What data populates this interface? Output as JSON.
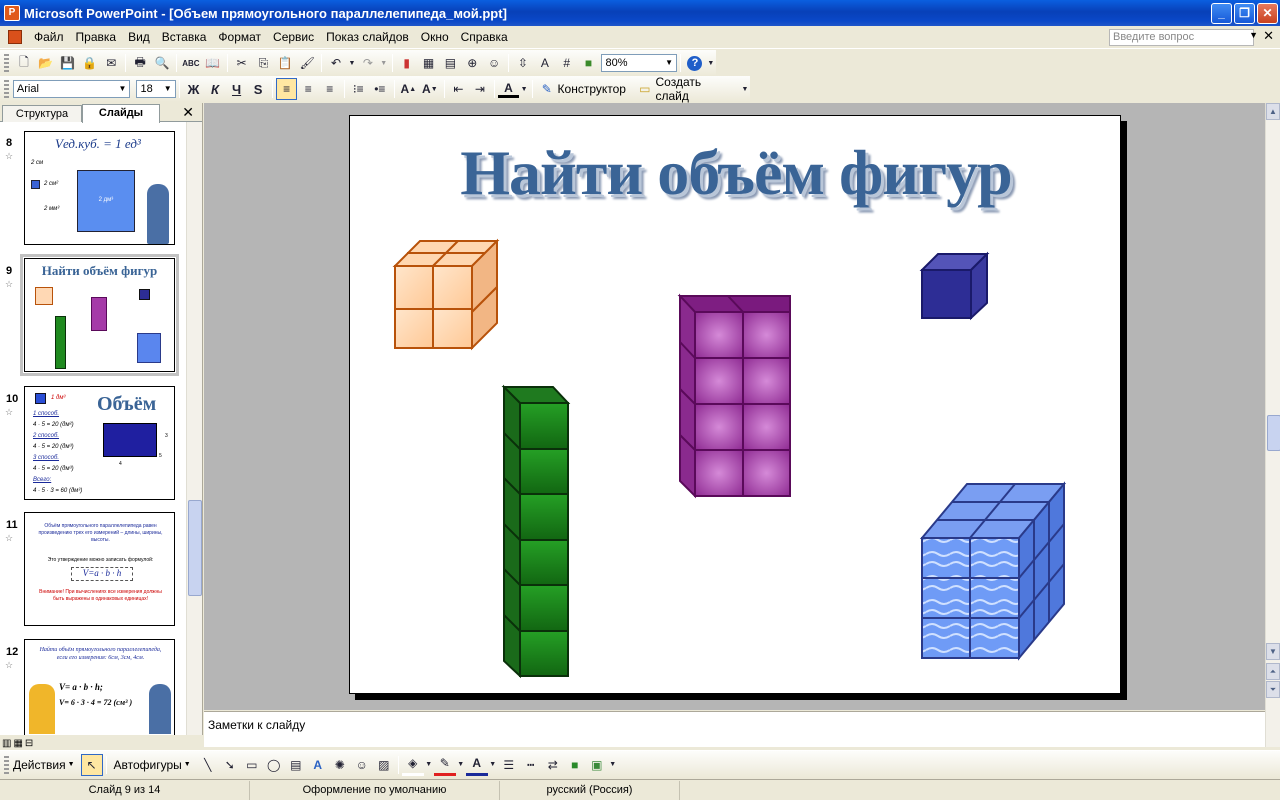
{
  "window": {
    "title": "Microsoft PowerPoint - [Объем прямоугольного параллелепипеда_мой.ppt]",
    "app_icon": "powerpoint-icon"
  },
  "menu": {
    "items": [
      "Файл",
      "Правка",
      "Вид",
      "Вставка",
      "Формат",
      "Сервис",
      "Показ слайдов",
      "Окно",
      "Справка"
    ],
    "ask_placeholder": "Введите вопрос"
  },
  "toolbar_standard": {
    "zoom": "80%"
  },
  "toolbar_formatting": {
    "font": "Arial",
    "size": "18",
    "bold": "Ж",
    "italic": "К",
    "underline": "Ч",
    "shadow": "S",
    "designer_label": "Конструктор",
    "new_slide_label": "Создать слайд"
  },
  "panel": {
    "tab_outline": "Структура",
    "tab_slides": "Слайды",
    "thumbnails": [
      {
        "num": "8",
        "formula": "Vед.куб. = 1 ед³",
        "labels": [
          "2 см",
          "2 см²",
          "2 мм³",
          "2 дм³"
        ]
      },
      {
        "num": "9",
        "title": "Найти объём фигур"
      },
      {
        "num": "10",
        "title": "Объём",
        "lines": [
          "1 способ.",
          "4 · 5 = 20 (дм²)",
          "2 способ.",
          "4 · 5 = 20 (дм³)",
          "3 способ.",
          "4 · 5 = 20 (дм³)",
          "Всего:",
          "4 · 5 · 3 = 60 (дм³)"
        ],
        "dims": [
          "4",
          "5",
          "3"
        ],
        "unit_label": "1 дм³"
      },
      {
        "num": "11",
        "text1": "Объём прямоугольного параллелепипеда равен произведению трех его измерений – длины, ширины, высоты.",
        "text2": "Это утверждение можно записать формулой:",
        "formula": "V=a · b · h",
        "warning": "Внимание! При вычислениях все измерения должны быть выражены в одинаковых единицах!"
      },
      {
        "num": "12",
        "text1": "Найти объём прямоугольного параллелепипеда, если его измерения: 6см, 3см, 4см.",
        "formula1": "V= a · b · h;",
        "formula2": "V= 6 · 3 · 4 = 72 (см³ )"
      }
    ]
  },
  "slide": {
    "title": "Найти объём фигур"
  },
  "notes": {
    "placeholder": "Заметки к слайду"
  },
  "drawing": {
    "actions": "Действия",
    "autoshapes": "Автофигуры"
  },
  "status": {
    "slide": "Слайд 9 из 14",
    "design": "Оформление по умолчанию",
    "language": "русский (Россия)"
  }
}
